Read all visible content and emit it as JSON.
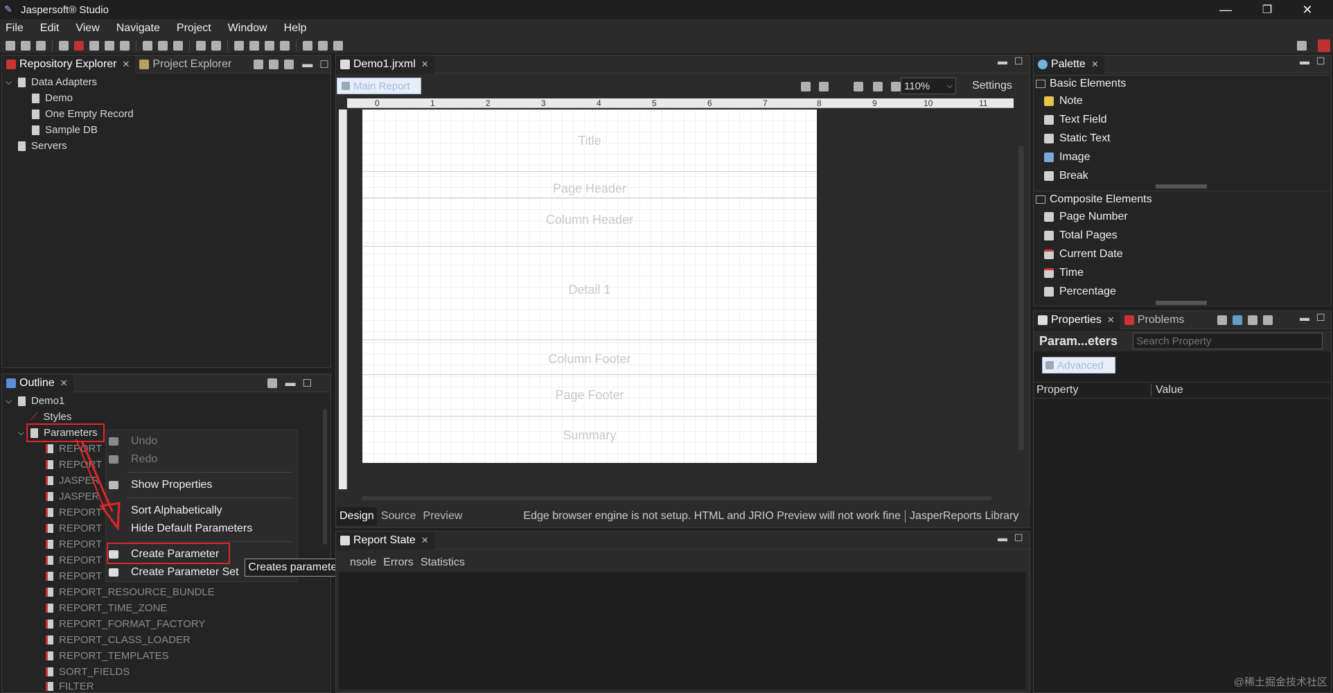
{
  "window": {
    "title": "Jaspersoft® Studio",
    "minimize": "—",
    "maximize": "❐",
    "close": "✕"
  },
  "menu": [
    "File",
    "Edit",
    "View",
    "Navigate",
    "Project",
    "Window",
    "Help"
  ],
  "left_top": {
    "tabs": [
      {
        "label": "Repository Explorer"
      },
      {
        "label": "Project Explorer"
      }
    ],
    "tree": [
      {
        "label": "Data Adapters",
        "level": 0,
        "expanded": true
      },
      {
        "label": "Demo",
        "level": 1
      },
      {
        "label": "One Empty Record",
        "level": 1
      },
      {
        "label": "Sample DB",
        "level": 1
      },
      {
        "label": "Servers",
        "level": 0
      }
    ]
  },
  "outline": {
    "tab": "Outline",
    "root": "Demo1",
    "styles": "Styles",
    "parameters": "Parameters",
    "items": [
      "REPORT",
      "REPORT",
      "JASPER",
      "JASPER",
      "REPORT",
      "REPORT",
      "REPORT",
      "REPORT",
      "REPORT",
      "REPORT_RESOURCE_BUNDLE",
      "REPORT_TIME_ZONE",
      "REPORT_FORMAT_FACTORY",
      "REPORT_CLASS_LOADER",
      "REPORT_TEMPLATES",
      "SORT_FIELDS",
      "FILTER"
    ]
  },
  "context_menu": {
    "undo": "Undo",
    "redo": "Redo",
    "show_properties": "Show Properties",
    "sort_alpha": "Sort Alphabetically",
    "hide_default": "Hide Default Parameters",
    "create_parameter": "Create Parameter",
    "create_parameter_set": "Create Parameter Set"
  },
  "tooltip": "Creates parameters",
  "editor": {
    "tab": "Demo1.jrxml",
    "main_report": "Main Report",
    "zoom": "110%",
    "settings": "Settings",
    "ruler_labels": [
      "0",
      "1",
      "2",
      "3",
      "4",
      "5",
      "6",
      "7",
      "8",
      "9",
      "10",
      "11"
    ],
    "bands": [
      "Title",
      "Page Header",
      "Column Header",
      "Detail 1",
      "Column Footer",
      "Page Footer",
      "Summary"
    ],
    "bottom_tabs": [
      "Design",
      "Source",
      "Preview"
    ],
    "status_msg": "Edge browser engine is not setup. HTML and JRIO Preview will not work fine",
    "status_lib": "JasperReports Library"
  },
  "report_state": {
    "tab": "Report State",
    "subtabs": [
      "nsole",
      "Errors",
      "Statistics"
    ]
  },
  "palette": {
    "tab": "Palette",
    "basic_header": "Basic Elements",
    "basic": [
      "Note",
      "Text Field",
      "Static Text",
      "Image",
      "Break"
    ],
    "composite_header": "Composite Elements",
    "composite": [
      "Page Number",
      "Total Pages",
      "Current Date",
      "Time",
      "Percentage"
    ]
  },
  "properties": {
    "tab": "Properties",
    "tab2": "Problems",
    "heading": "Param...eters",
    "search_placeholder": "Search Property",
    "advanced": "Advanced",
    "col_property": "Property",
    "col_value": "Value"
  },
  "watermark": "@稀土掘金技术社区"
}
